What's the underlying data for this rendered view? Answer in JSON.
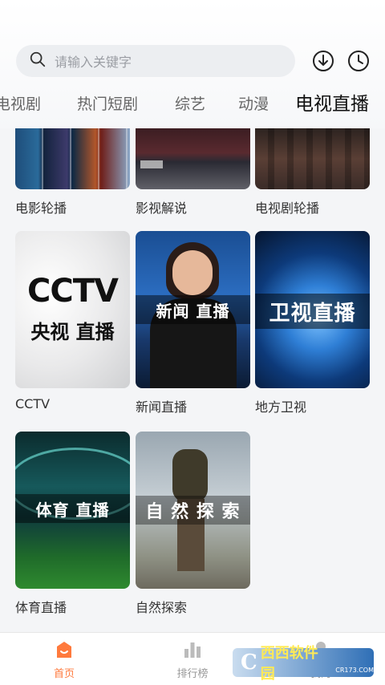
{
  "search": {
    "placeholder": "请输入关键字"
  },
  "toolbar": {
    "download_icon": "download-icon",
    "history_icon": "history-icon"
  },
  "tabs": [
    {
      "label": "电视剧"
    },
    {
      "label": "热门短剧"
    },
    {
      "label": "综艺"
    },
    {
      "label": "动漫"
    },
    {
      "label": "电视直播",
      "active": true
    }
  ],
  "cards": [
    {
      "label": "电影轮播"
    },
    {
      "label": "影视解说"
    },
    {
      "label": "电视剧轮播"
    },
    {
      "label": "CCTV",
      "logo_text": "CCTV",
      "overlay": "央视 直播"
    },
    {
      "label": "新闻直播",
      "overlay": "新闻 直播"
    },
    {
      "label": "地方卫视",
      "overlay": "卫视直播"
    },
    {
      "label": "体育直播",
      "overlay": "体育 直播"
    },
    {
      "label": "自然探索",
      "overlay": "自 然 探 索"
    }
  ],
  "bottom_nav": [
    {
      "label": "首页",
      "active": true
    },
    {
      "label": "排行榜"
    },
    {
      "label": "我的"
    }
  ],
  "watermark": {
    "logo": "C",
    "brand": "西西软件园",
    "domain": "CR173.COM"
  },
  "colors": {
    "accent": "#ff7a3d"
  }
}
